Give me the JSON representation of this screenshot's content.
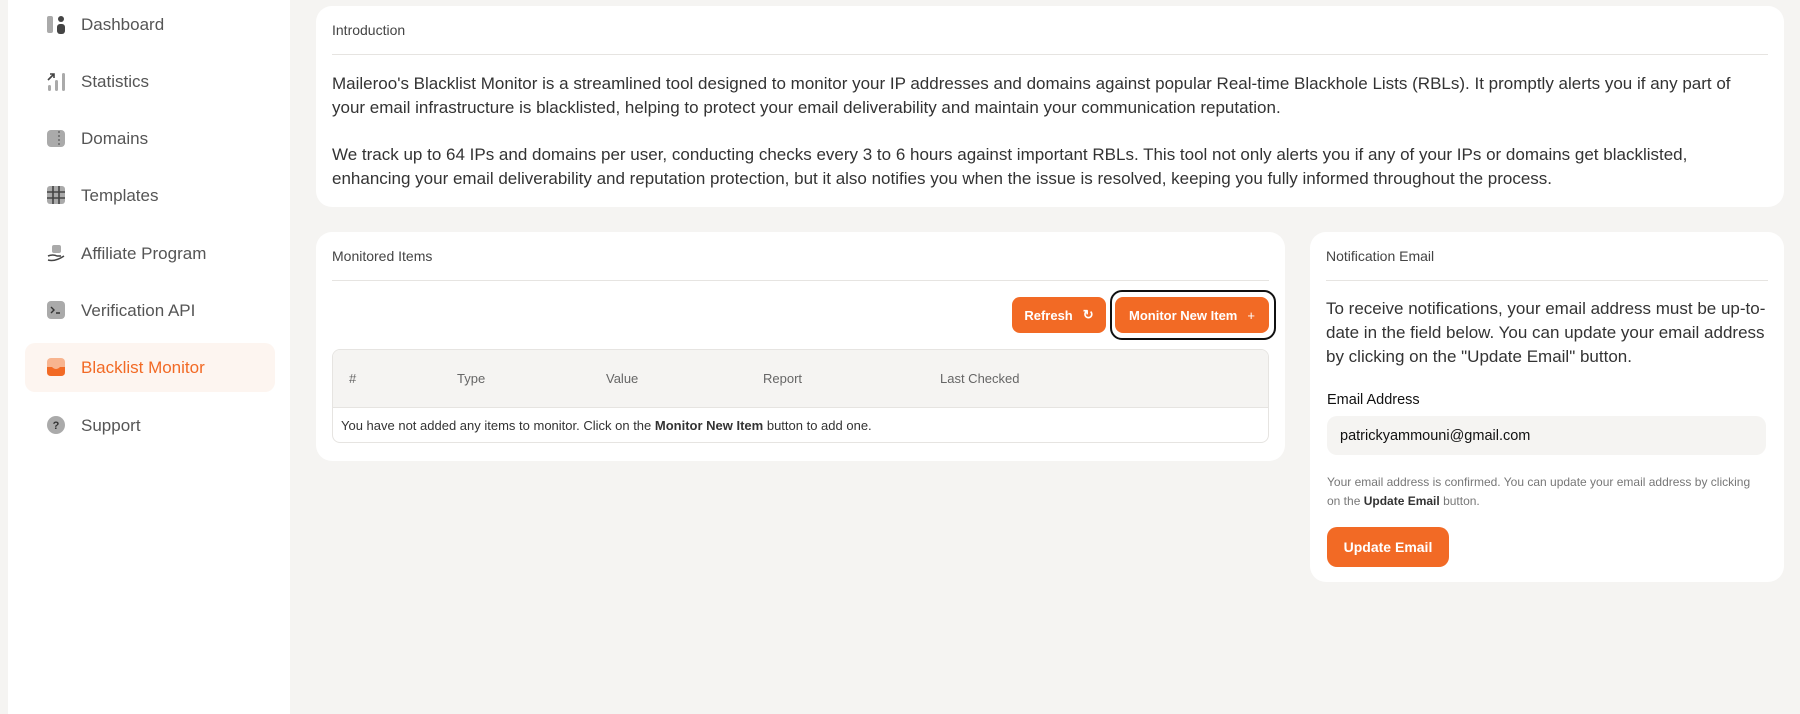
{
  "sidebar": {
    "items": [
      {
        "label": "Dashboard",
        "icon": "dashboard-icon"
      },
      {
        "label": "Statistics",
        "icon": "statistics-icon"
      },
      {
        "label": "Domains",
        "icon": "domains-icon"
      },
      {
        "label": "Templates",
        "icon": "templates-icon"
      },
      {
        "label": "Affiliate Program",
        "icon": "affiliate-icon"
      },
      {
        "label": "Verification API",
        "icon": "terminal-icon"
      },
      {
        "label": "Blacklist Monitor",
        "icon": "inbox-icon",
        "active": true
      },
      {
        "label": "Support",
        "icon": "help-icon"
      }
    ]
  },
  "intro": {
    "title": "Introduction",
    "p1": "Maileroo's Blacklist Monitor is a streamlined tool designed to monitor your IP addresses and domains against popular Real-time Blackhole Lists (RBLs). It promptly alerts you if any part of your email infrastructure is blacklisted, helping to protect your email deliverability and maintain your communication reputation.",
    "p2": "We track up to 64 IPs and domains per user, conducting checks every 3 to 6 hours against important RBLs. This tool not only alerts you if any of your IPs or domains get blacklisted, enhancing your email deliverability and reputation protection, but it also notifies you when the issue is resolved, keeping you fully informed throughout the process."
  },
  "monitored": {
    "title": "Monitored Items",
    "refresh_label": "Refresh",
    "monitor_label": "Monitor New Item",
    "columns": [
      "#",
      "Type",
      "Value",
      "Report",
      "Last Checked"
    ],
    "empty_pre": "You have not added any items to monitor. Click on the ",
    "empty_bold": "Monitor New Item",
    "empty_post": " button to add one."
  },
  "notification": {
    "title": "Notification Email",
    "description": "To receive notifications, your email address must be up-to-date in the field below. You can update your email address by clicking on the \"Update Email\" button.",
    "email_label": "Email Address",
    "email_value": "patrickyammouni@gmail.com",
    "help_pre": "Your email address is confirmed. You can update your email address by clicking on the ",
    "help_bold": "Update Email",
    "help_post": " button.",
    "button_label": "Update Email"
  },
  "colors": {
    "accent": "#f26a25",
    "background": "#f5f4f2"
  }
}
